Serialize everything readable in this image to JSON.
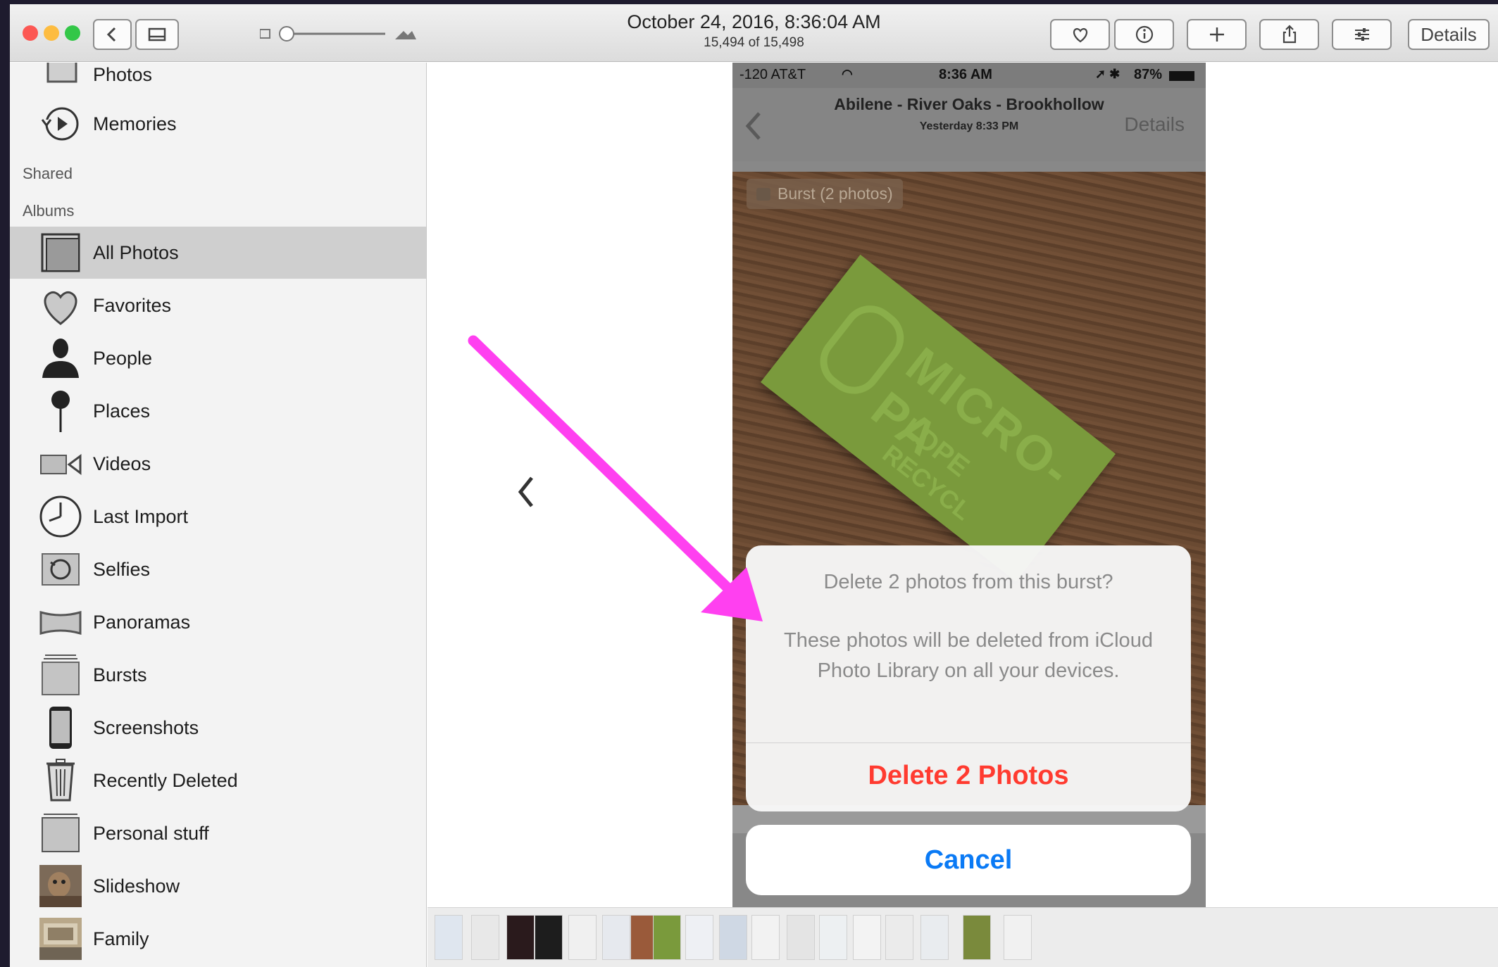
{
  "window": {
    "title": "October 24, 2016, 8:36:04 AM",
    "subtitle": "15,494 of 15,498",
    "details_label": "Details"
  },
  "sidebar": {
    "top_items": [
      {
        "label": "Photos",
        "icon": "photos-icon"
      },
      {
        "label": "Memories",
        "icon": "memories-icon"
      }
    ],
    "shared_header": "Shared",
    "albums_header": "Albums",
    "albums": [
      {
        "label": "All Photos",
        "icon": "all-photos-icon",
        "selected": true
      },
      {
        "label": "Favorites",
        "icon": "heart-icon"
      },
      {
        "label": "People",
        "icon": "person-icon"
      },
      {
        "label": "Places",
        "icon": "pin-icon"
      },
      {
        "label": "Videos",
        "icon": "video-camera-icon"
      },
      {
        "label": "Last Import",
        "icon": "clock-icon"
      },
      {
        "label": "Selfies",
        "icon": "selfie-camera-icon"
      },
      {
        "label": "Panoramas",
        "icon": "panorama-icon"
      },
      {
        "label": "Bursts",
        "icon": "bursts-icon"
      },
      {
        "label": "Screenshots",
        "icon": "phone-icon"
      },
      {
        "label": "Recently Deleted",
        "icon": "trash-icon"
      },
      {
        "label": "Personal stuff",
        "icon": "album-icon"
      },
      {
        "label": "Slideshow",
        "icon": "slideshow-thumb"
      },
      {
        "label": "Family",
        "icon": "family-thumb"
      }
    ]
  },
  "phone": {
    "carrier": "-120 AT&T",
    "time": "8:36 AM",
    "battery": "87%",
    "nav_title": "Abilene - River Oaks - Brookhollow",
    "nav_subtitle": "Yesterday  8:33 PM",
    "nav_details": "Details",
    "burst_tag": "Burst (2 photos)",
    "card_text_1": "MICRO-PA",
    "card_text_2": "LDPE",
    "card_text_3": "RECYCL"
  },
  "alert": {
    "question": "Delete 2 photos from this burst?",
    "message": "These photos will be deleted from iCloud Photo Library on all your devices.",
    "delete_label": "Delete 2 Photos",
    "cancel_label": "Cancel"
  },
  "colors": {
    "destructive": "#ff3b30",
    "ios_blue": "#0a7af5",
    "annotation_arrow": "#ff40f0",
    "selected_row": "#cfcfcf"
  }
}
